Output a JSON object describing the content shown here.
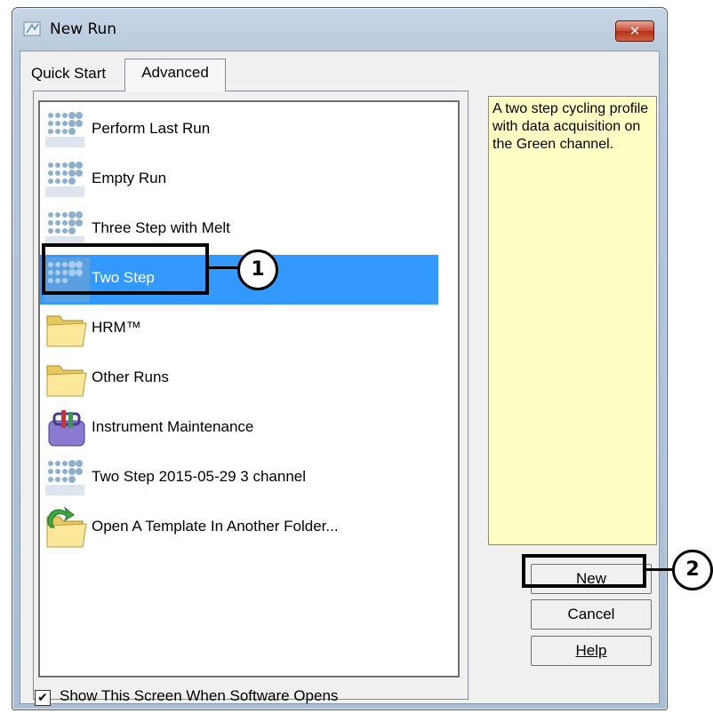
{
  "window": {
    "title": "New Run",
    "close_glyph": "✕"
  },
  "tabs": [
    {
      "label": "Quick Start"
    },
    {
      "label": "Advanced"
    }
  ],
  "items": [
    {
      "label": "Perform Last Run",
      "icon": "qiagen-template-icon"
    },
    {
      "label": "Empty Run",
      "icon": "qiagen-template-icon"
    },
    {
      "label": "Three Step with Melt",
      "icon": "qiagen-template-icon"
    },
    {
      "label": "Two Step",
      "icon": "qiagen-template-icon",
      "selected": true
    },
    {
      "label": "HRM™",
      "icon": "folder-icon"
    },
    {
      "label": "Other Runs",
      "icon": "folder-icon"
    },
    {
      "label": "Instrument Maintenance",
      "icon": "toolbox-icon"
    },
    {
      "label": "Two Step 2015-05-29 3 channel",
      "icon": "qiagen-template-icon"
    },
    {
      "label": "Open A Template In Another Folder...",
      "icon": "open-folder-icon"
    }
  ],
  "description": "A two step cycling profile with data acquisition on the Green channel.",
  "buttons": {
    "new": "New",
    "cancel": "Cancel",
    "help": "Help"
  },
  "show_screen": {
    "label": "Show This Screen When Software Opens",
    "checked": true,
    "mark": "✔"
  },
  "callouts": {
    "one": "1",
    "two": "2"
  },
  "colors": {
    "selection": "#3399ff",
    "description_bg": "#ffffc4"
  }
}
